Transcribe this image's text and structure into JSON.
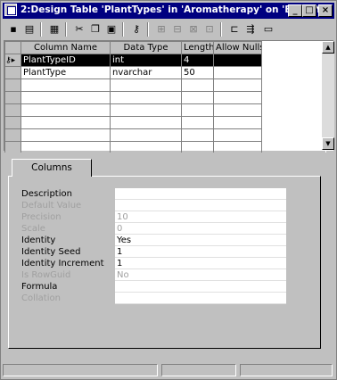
{
  "window": {
    "title": "2:Design Table 'PlantTypes' in 'Aromatherapy' on 'BUNNY'"
  },
  "title_buttons": [
    "minimize",
    "maximize",
    "close"
  ],
  "toolbar": {
    "icons": [
      "save-icon",
      "properties-icon",
      "table-icon",
      "cut-icon",
      "copy-icon",
      "paste-icon",
      "primary-key-icon",
      "insert-column-icon",
      "delete-column-icon",
      "manage-relationships-icon",
      "manage-indexes-icon",
      "manage-constraints-icon",
      "manage-triggers-icon",
      "generate-script-icon"
    ]
  },
  "grid": {
    "columns": [
      "Column Name",
      "Data Type",
      "Length",
      "Allow Nulls"
    ],
    "rows": [
      {
        "name": "PlantTypeID",
        "type": "int",
        "length": "4",
        "allow_nulls": ""
      },
      {
        "name": "PlantType",
        "type": "nvarchar",
        "length": "50",
        "allow_nulls": ""
      }
    ],
    "selected_row": 0
  },
  "tabs": [
    {
      "label": "Columns"
    }
  ],
  "properties": [
    {
      "label": "Description",
      "value": "",
      "enabled": true
    },
    {
      "label": "Default Value",
      "value": "",
      "enabled": false
    },
    {
      "label": "Precision",
      "value": "10",
      "enabled": false
    },
    {
      "label": "Scale",
      "value": "0",
      "enabled": false
    },
    {
      "label": "Identity",
      "value": "Yes",
      "enabled": true
    },
    {
      "label": "Identity Seed",
      "value": "1",
      "enabled": true
    },
    {
      "label": "Identity Increment",
      "value": "1",
      "enabled": true
    },
    {
      "label": "Is RowGuid",
      "value": "No",
      "enabled": false
    },
    {
      "label": "Formula",
      "value": "",
      "enabled": true
    },
    {
      "label": "Collation",
      "value": "",
      "enabled": false
    }
  ]
}
